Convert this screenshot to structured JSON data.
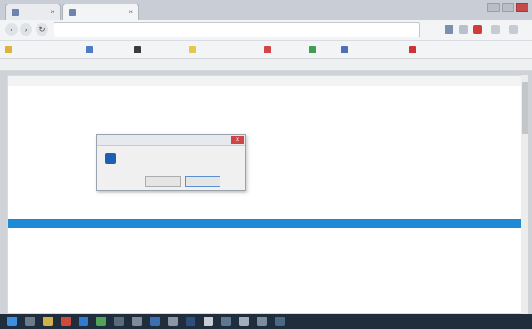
{
  "window": {
    "tabs": [
      {
        "label": "",
        "active": false
      },
      {
        "label": "",
        "active": true
      }
    ]
  },
  "address_bar": {
    "url": ""
  },
  "bookmarks": [
    {
      "label": ""
    },
    {
      "label": ""
    },
    {
      "label": ""
    },
    {
      "label": ""
    },
    {
      "label": ""
    },
    {
      "label": ""
    },
    {
      "label": ""
    },
    {
      "label": ""
    }
  ],
  "file_table": {
    "columns": [
      "",
      "",
      "",
      ""
    ],
    "selected_row_index": 14,
    "rows": [
      [
        "",
        "",
        "",
        ""
      ],
      [
        "",
        "",
        "",
        ""
      ],
      [
        "",
        "",
        "",
        ""
      ],
      [
        "",
        "",
        "",
        ""
      ],
      [
        "",
        "",
        "",
        ""
      ],
      [
        "",
        "",
        "",
        ""
      ],
      [
        "",
        "",
        "",
        ""
      ],
      [
        "",
        "",
        "",
        ""
      ],
      [
        "",
        "",
        "",
        ""
      ],
      [
        "",
        "",
        "",
        ""
      ],
      [
        "",
        "",
        "",
        ""
      ],
      [
        "",
        "",
        "",
        ""
      ],
      [
        "",
        "",
        "",
        ""
      ],
      [
        "",
        "",
        "",
        ""
      ],
      [
        "",
        "",
        "",
        ""
      ],
      [
        "",
        "",
        "",
        ""
      ],
      [
        "",
        "",
        "",
        ""
      ],
      [
        "",
        "",
        "",
        ""
      ],
      [
        "",
        "",
        "",
        ""
      ],
      [
        "",
        "",
        "",
        ""
      ],
      [
        "",
        "",
        "",
        ""
      ],
      [
        "",
        "",
        "",
        ""
      ],
      [
        "",
        "",
        "",
        ""
      ],
      [
        "",
        "",
        "",
        ""
      ]
    ]
  },
  "dialog": {
    "title": "",
    "message": "",
    "ok_label": "",
    "cancel_label": ""
  },
  "taskbar": {
    "clock": ""
  },
  "colors": {
    "selection": "#1e8ad6",
    "taskbar": "#1f2d3d",
    "close_button": "#cf4545"
  }
}
